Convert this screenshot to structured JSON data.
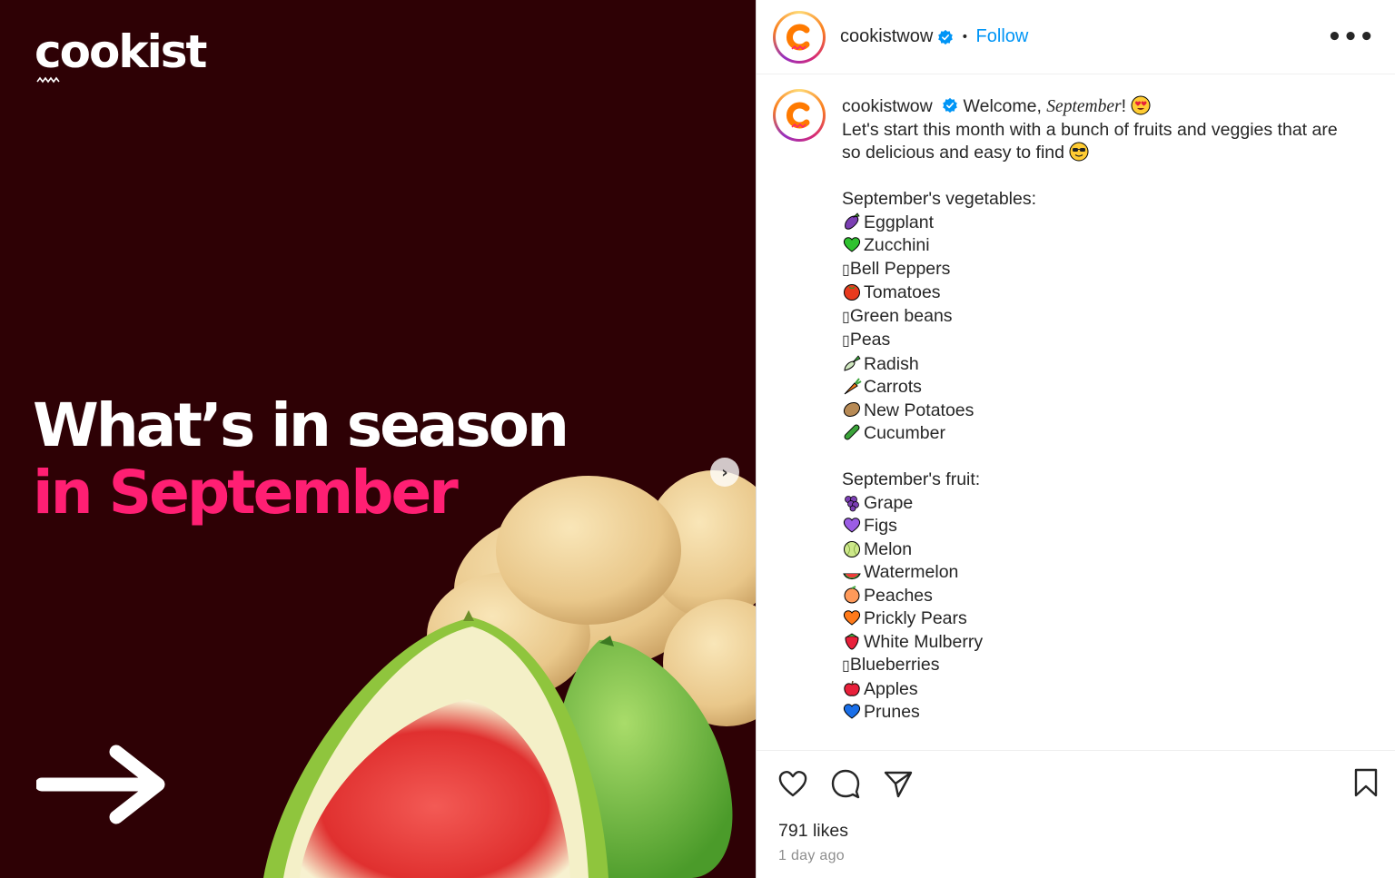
{
  "media": {
    "brand": "cookist",
    "headline_line1": "What’s in season",
    "headline_line2": "in September",
    "next_glyph": "›"
  },
  "header": {
    "username": "cookistwow",
    "follow_label": "Follow",
    "more_glyph": "•••"
  },
  "caption": {
    "username": "cookistwow",
    "intro_prefix": "Welcome, ",
    "intro_italic": "September",
    "intro_suffix": "!",
    "line2": "Let's start this month with a bunch of fruits and veggies that are",
    "line3": "so delicious and easy to find",
    "veg_heading": "September's vegetables:",
    "vegetables": [
      {
        "icon": "eggplant-icon",
        "label": "Eggplant"
      },
      {
        "icon": "green-heart-icon",
        "label": "Zucchini"
      },
      {
        "icon": "missing-glyph-box",
        "label": "Bell Peppers"
      },
      {
        "icon": "tomato-icon",
        "label": "Tomatoes"
      },
      {
        "icon": "missing-glyph-box",
        "label": "Green beans"
      },
      {
        "icon": "missing-glyph-box",
        "label": "Peas"
      },
      {
        "icon": "radish-icon",
        "label": "Radish"
      },
      {
        "icon": "carrot-icon",
        "label": "Carrots"
      },
      {
        "icon": "potato-icon",
        "label": "New Potatoes"
      },
      {
        "icon": "cucumber-icon",
        "label": "Cucumber"
      }
    ],
    "fruit_heading": "September's fruit:",
    "fruits": [
      {
        "icon": "grapes-icon",
        "label": "Grape"
      },
      {
        "icon": "purple-heart-icon",
        "label": "Figs"
      },
      {
        "icon": "melon-icon",
        "label": "Melon"
      },
      {
        "icon": "watermelon-icon",
        "label": "Watermelon"
      },
      {
        "icon": "peach-icon",
        "label": "Peaches"
      },
      {
        "icon": "orange-heart-icon",
        "label": "Prickly Pears"
      },
      {
        "icon": "strawberry-icon",
        "label": "White Mulberry"
      },
      {
        "icon": "missing-glyph-box",
        "label": "Blueberries"
      },
      {
        "icon": "apple-icon",
        "label": "Apples"
      },
      {
        "icon": "blue-heart-icon",
        "label": "Prunes"
      }
    ],
    "missing_glyph": "▯"
  },
  "footer": {
    "likes": "791 likes",
    "time": "1 day ago"
  },
  "colors": {
    "media_bg": "#2e0105",
    "headline_accent": "#ff1f73",
    "follow": "#0095f6"
  }
}
